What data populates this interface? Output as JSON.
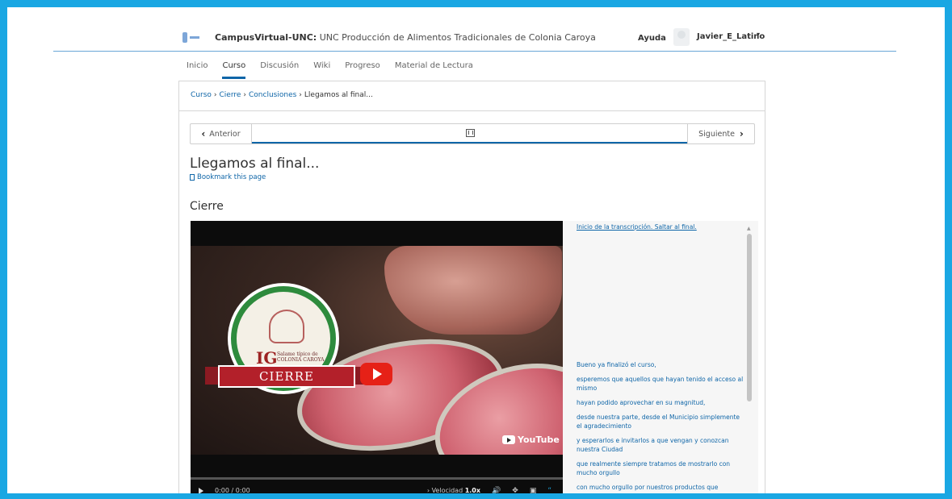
{
  "header": {
    "site_name": "CampusVirtual-UNC:",
    "course_name": "UNC Producción de Alimentos Tradicionales de Colonia Caroya",
    "help_label": "Ayuda",
    "username": "Javier_E_Latino",
    "caret": "▾"
  },
  "tabs": [
    {
      "label": "Inicio"
    },
    {
      "label": "Curso"
    },
    {
      "label": "Discusión"
    },
    {
      "label": "Wiki"
    },
    {
      "label": "Progreso"
    },
    {
      "label": "Material de Lectura"
    }
  ],
  "breadcrumb": {
    "items": [
      "Curso",
      "Cierre",
      "Conclusiones"
    ],
    "current": "Llegamos al final...",
    "separator": "›"
  },
  "sequence_nav": {
    "prev_label": "Anterior",
    "next_label": "Siguiente",
    "prev_icon": "chevron-left-icon",
    "next_icon": "chevron-right-icon",
    "unit_icon": "video-icon"
  },
  "page": {
    "title": "Llegamos al final...",
    "bookmark_label": "Bookmark this page",
    "section_title": "Cierre"
  },
  "video": {
    "badge_ig": "IG",
    "badge_text": "Salame típico de COLONIA CAROYA",
    "ribbon_text": "CIERRE",
    "youtube_label": "YouTube",
    "time": "0:00 / 0:00",
    "speed_label": "Velocidad",
    "speed_value": "1.0x",
    "progress": 0
  },
  "transcript": {
    "skip_link": "Inicio de la transcripción. Saltar al final.",
    "lines": [
      "Bueno ya finalizó el curso,",
      "esperemos que aquellos que hayan tenido el acceso al mismo",
      "hayan podido aprovechar en su magnitud,",
      "desde nuestra parte, desde el Municipio simplemente el agradecimiento",
      "y esperarlos e invitarlos a que vengan y conozcan nuestra Ciudad",
      "que realmente siempre tratamos de mostrarlo con mucho orgullo",
      "con mucho orgullo por nuestros productos que"
    ]
  },
  "colors": {
    "frame": "#1aa7e3",
    "link": "#0f66a8",
    "youtube_red": "#e62117"
  }
}
